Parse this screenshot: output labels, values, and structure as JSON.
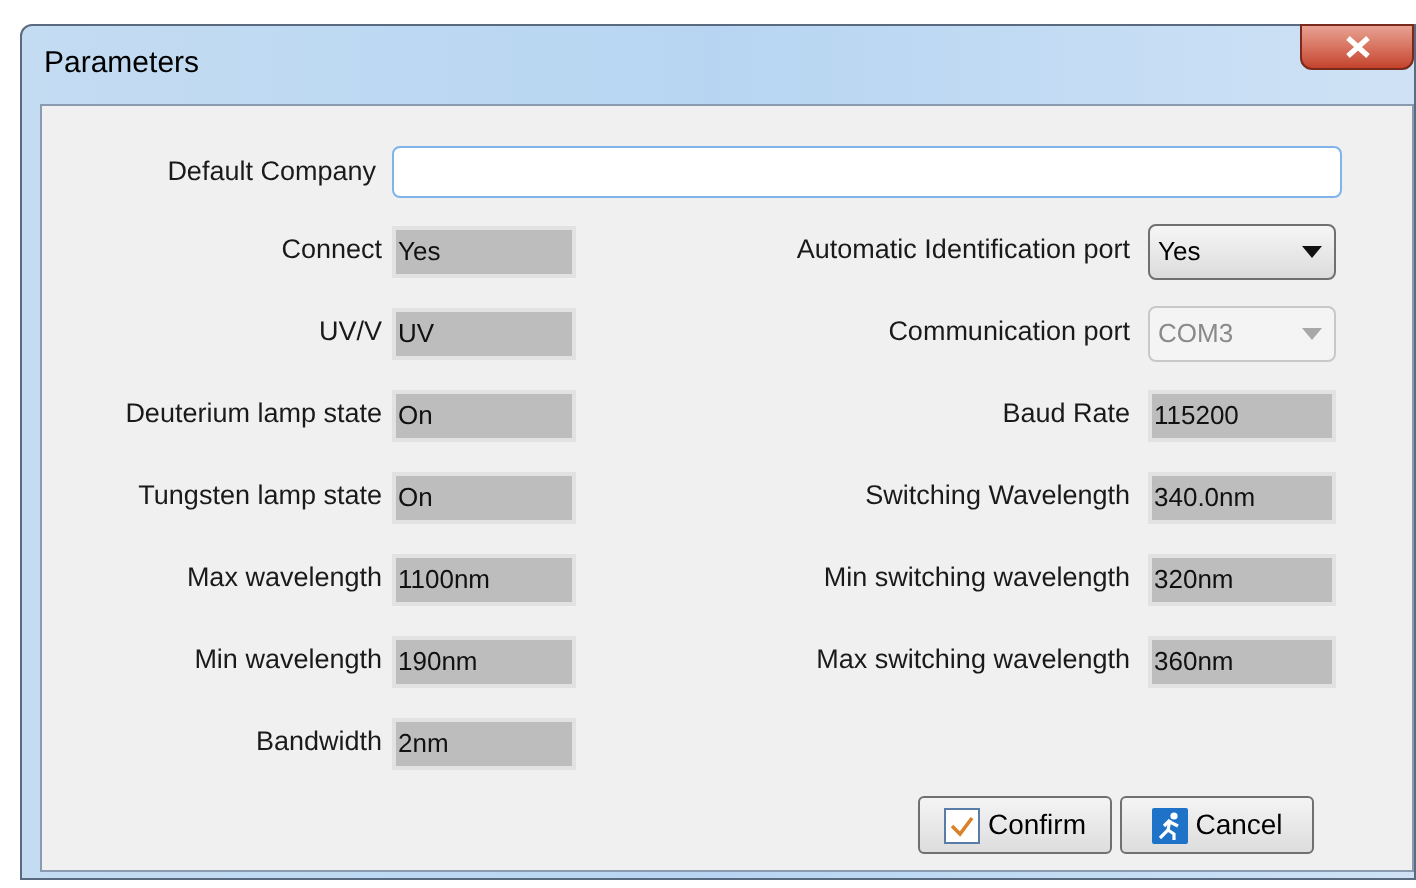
{
  "window": {
    "title": "Parameters"
  },
  "default_company": {
    "label": "Default Company"
  },
  "left_fields": [
    {
      "label": "Connect",
      "kind": "readonly",
      "value": "Yes"
    },
    {
      "label": "UV/V",
      "kind": "readonly",
      "value": "UV"
    },
    {
      "label": "Deuterium lamp state",
      "kind": "readonly",
      "value": "On"
    },
    {
      "label": "Tungsten lamp state",
      "kind": "readonly",
      "value": "On"
    },
    {
      "label": "Max wavelength",
      "kind": "readonly",
      "value": "1100nm"
    },
    {
      "label": "Min wavelength",
      "kind": "readonly",
      "value": "190nm"
    },
    {
      "label": "Bandwidth",
      "kind": "readonly",
      "value": "2nm"
    }
  ],
  "right_fields": [
    {
      "label": "Automatic Identification port",
      "kind": "dropdown",
      "value": "Yes",
      "disabled": false
    },
    {
      "label": "Communication port",
      "kind": "dropdown",
      "value": "COM3",
      "disabled": true
    },
    {
      "label": "Baud Rate",
      "kind": "readonly",
      "value": "115200"
    },
    {
      "label": "Switching Wavelength",
      "kind": "readonly",
      "value": "340.0nm"
    },
    {
      "label": "Min switching wavelength",
      "kind": "readonly",
      "value": "320nm"
    },
    {
      "label": "Max switching wavelength",
      "kind": "readonly",
      "value": "360nm"
    }
  ],
  "buttons": [
    {
      "label": "Confirm",
      "kind": "confirm"
    },
    {
      "label": "Cancel",
      "kind": "cancel"
    }
  ]
}
